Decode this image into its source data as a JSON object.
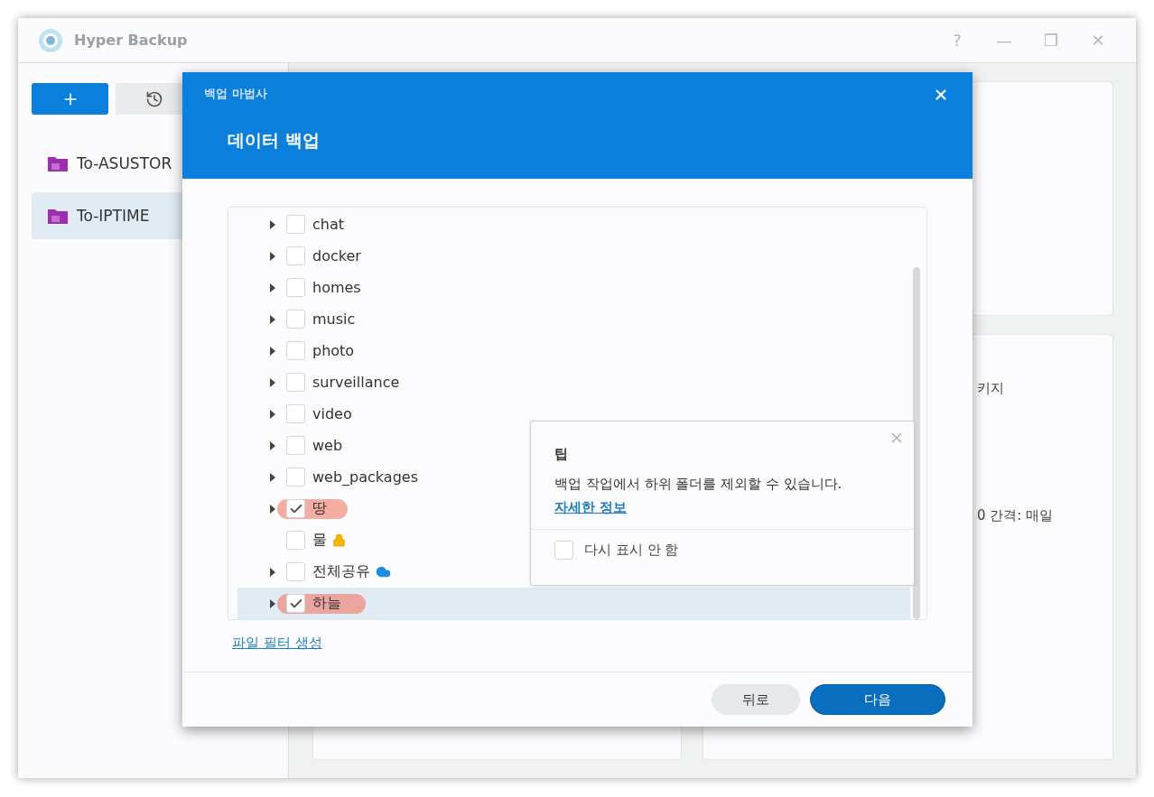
{
  "window": {
    "title": "Hyper Backup",
    "controls": [
      "?",
      "—",
      "❐",
      "✕"
    ]
  },
  "sidebar": {
    "items": [
      {
        "label": "To-ASUSTOR",
        "selected": false
      },
      {
        "label": "To-IPTIME",
        "selected": true
      }
    ]
  },
  "background_texts": [
    "키지",
    "0 간격: 매일"
  ],
  "wizard": {
    "title": "백업 마법사",
    "heading": "데이터 백업",
    "tree": [
      {
        "label": "chat",
        "expandable": true,
        "checked": false,
        "selected": false,
        "marked": false
      },
      {
        "label": "docker",
        "expandable": true,
        "checked": false,
        "selected": false,
        "marked": false
      },
      {
        "label": "homes",
        "expandable": true,
        "checked": false,
        "selected": false,
        "marked": false
      },
      {
        "label": "music",
        "expandable": true,
        "checked": false,
        "selected": false,
        "marked": false
      },
      {
        "label": "photo",
        "expandable": true,
        "checked": false,
        "selected": false,
        "marked": false
      },
      {
        "label": "surveillance",
        "expandable": true,
        "checked": false,
        "selected": false,
        "marked": false
      },
      {
        "label": "video",
        "expandable": true,
        "checked": false,
        "selected": false,
        "marked": false
      },
      {
        "label": "web",
        "expandable": true,
        "checked": false,
        "selected": false,
        "marked": false
      },
      {
        "label": "web_packages",
        "expandable": true,
        "checked": false,
        "selected": false,
        "marked": false
      },
      {
        "label": "땅",
        "expandable": true,
        "checked": true,
        "selected": false,
        "marked": true
      },
      {
        "label": "물",
        "expandable": false,
        "checked": false,
        "selected": false,
        "marked": false,
        "kind": "locked"
      },
      {
        "label": "전체공유",
        "expandable": true,
        "checked": false,
        "selected": false,
        "marked": false,
        "kind": "cloud"
      },
      {
        "label": "하늘",
        "expandable": true,
        "checked": true,
        "selected": true,
        "marked": true
      }
    ],
    "filter_link": "파일 필터 생성",
    "tip": {
      "title": "팁",
      "text": "백업 작업에서 하위 폴더를 제외할 수 있습니다.",
      "link": "자세한 정보",
      "dont_show_label": "다시 표시 안 함",
      "dont_show_checked": false
    },
    "buttons": [
      {
        "label": "뒤로",
        "kind": "secondary"
      },
      {
        "label": "다음",
        "kind": "primary"
      }
    ]
  }
}
